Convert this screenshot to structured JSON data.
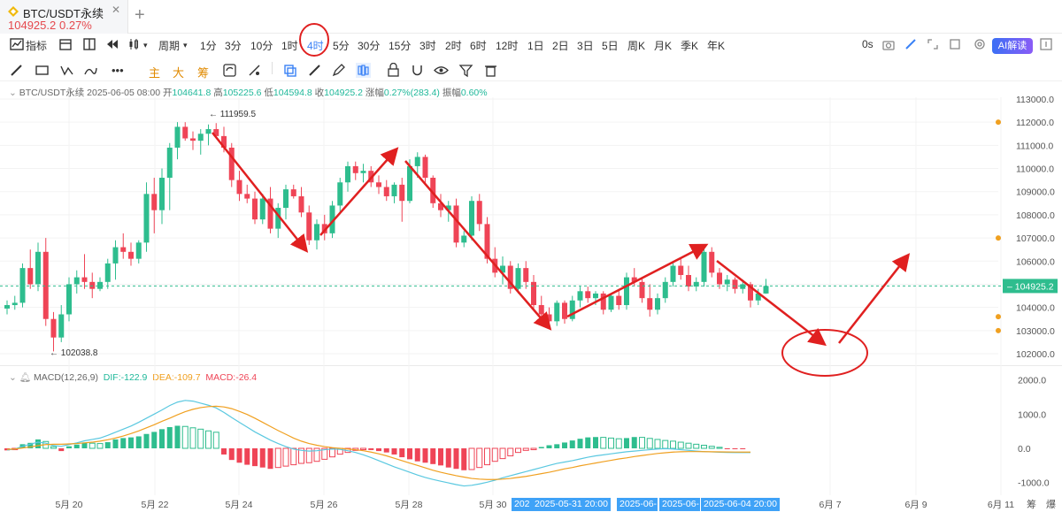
{
  "tab": {
    "symbol": "BTC/USDT永续",
    "price": "104925.2",
    "change_pct": "0.27%",
    "close_icon": "close-icon",
    "add_icon": "plus-icon"
  },
  "toolbar": {
    "indicator_label": "指标",
    "period_label": "周期",
    "intervals": [
      "1分",
      "3分",
      "10分",
      "1时",
      "4时",
      "5分",
      "30分",
      "15分",
      "3时",
      "2时",
      "6时",
      "12时",
      "1日",
      "2日",
      "3日",
      "5日",
      "周K",
      "月K",
      "季K",
      "年K"
    ],
    "active_interval": "4时",
    "countdown": "0s",
    "ai_button": "AI解读"
  },
  "drawing_tools": {
    "text_tools": [
      "主",
      "大",
      "筹"
    ]
  },
  "info": {
    "title": "BTC/USDT永续",
    "datetime": "2025-06-05 08:00",
    "open_label": "开",
    "open": "104641.8",
    "high_label": "高",
    "high": "105225.6",
    "low_label": "低",
    "low": "104594.8",
    "close_label": "收",
    "close": "104925.2",
    "change_label": "涨幅",
    "change": "0.27%(283.4)",
    "amplitude_label": "振幅",
    "amplitude": "0.60%"
  },
  "macd": {
    "label": "MACD(12,26,9)",
    "dif": "DIF:-122.9",
    "dea": "DEA:-109.7",
    "macd": "MACD:-26.4",
    "y_ticks": [
      "2000.0",
      "1000.0",
      "0.0",
      "-1000.0"
    ]
  },
  "colors": {
    "up": "#2ebd8e",
    "down": "#ef4456",
    "dif": "#5ac8e0",
    "dea": "#f0a020",
    "annotation": "#e02020",
    "accent": "#3b82f6"
  },
  "chart_data": {
    "type": "candlestick",
    "y_ticks": [
      "113000.0",
      "112000.0",
      "111000.0",
      "110000.0",
      "109000.0",
      "108000.0",
      "107000.0",
      "106000.0",
      "105000.0",
      "104000.0",
      "103000.0",
      "102000.0"
    ],
    "ylim": [
      101600,
      113200
    ],
    "high_marker": "111959.5",
    "low_marker": "102038.8",
    "last_price": "104925.2",
    "x_ticks": [
      "5月 20",
      "5月 22",
      "5月 24",
      "5月 26",
      "5月 28",
      "5月 30",
      "6月 7",
      "6月 9",
      "6月 11"
    ],
    "crosshair_labels": [
      "2025-05-31 20:00",
      "2025-06-04 20:00"
    ],
    "crosshair_truncated": [
      "202",
      "2025-06-",
      "2025-06-"
    ],
    "right_bottom_labels": [
      "筹",
      "爆"
    ],
    "candles": [
      [
        103950,
        104300,
        103700,
        104100
      ],
      [
        104100,
        104500,
        103900,
        104200
      ],
      [
        104200,
        105900,
        104000,
        105700
      ],
      [
        105700,
        106500,
        104800,
        105000
      ],
      [
        105000,
        106800,
        104700,
        106400
      ],
      [
        106400,
        107000,
        103200,
        103500
      ],
      [
        103500,
        103800,
        102100,
        102700
      ],
      [
        102700,
        104100,
        102500,
        103700
      ],
      [
        103700,
        105300,
        103400,
        105000
      ],
      [
        105000,
        105600,
        104600,
        105300
      ],
      [
        105300,
        106300,
        104800,
        105100
      ],
      [
        105100,
        105500,
        104400,
        104800
      ],
      [
        104800,
        105300,
        104700,
        105100
      ],
      [
        105100,
        106100,
        104800,
        105900
      ],
      [
        105900,
        106900,
        105200,
        106600
      ],
      [
        106600,
        107200,
        106100,
        106400
      ],
      [
        106400,
        106800,
        105800,
        106100
      ],
      [
        106100,
        106900,
        105900,
        106800
      ],
      [
        106800,
        109400,
        106400,
        108900
      ],
      [
        108900,
        109600,
        107200,
        108200
      ],
      [
        108200,
        110000,
        107600,
        109600
      ],
      [
        109600,
        111100,
        108200,
        110900
      ],
      [
        110900,
        112000,
        110400,
        111800
      ],
      [
        111800,
        112000,
        111200,
        111300
      ],
      [
        111300,
        111600,
        110800,
        111200
      ],
      [
        111200,
        111700,
        110600,
        111500
      ],
      [
        111500,
        111900,
        111000,
        111700
      ],
      [
        111700,
        111960,
        111300,
        111400
      ],
      [
        111400,
        111800,
        110700,
        110900
      ],
      [
        110900,
        111100,
        109200,
        109500
      ],
      [
        109500,
        109900,
        108600,
        108900
      ],
      [
        108900,
        109300,
        108500,
        108700
      ],
      [
        108700,
        109000,
        107600,
        107800
      ],
      [
        107800,
        108900,
        107600,
        108700
      ],
      [
        108700,
        109200,
        107200,
        107400
      ],
      [
        107400,
        108500,
        107000,
        108300
      ],
      [
        108300,
        109300,
        107800,
        109100
      ],
      [
        109100,
        109300,
        108700,
        108800
      ],
      [
        108800,
        109200,
        107900,
        108100
      ],
      [
        108100,
        108400,
        106700,
        106900
      ],
      [
        106900,
        107800,
        106500,
        107600
      ],
      [
        107600,
        108000,
        106900,
        107200
      ],
      [
        107200,
        108600,
        107000,
        108400
      ],
      [
        108400,
        109600,
        108100,
        109400
      ],
      [
        109400,
        110300,
        109000,
        110100
      ],
      [
        110100,
        110300,
        109500,
        109800
      ],
      [
        109800,
        110200,
        109400,
        109900
      ],
      [
        109900,
        110100,
        109200,
        109400
      ],
      [
        109400,
        109700,
        108900,
        109200
      ],
      [
        109200,
        109500,
        108600,
        108800
      ],
      [
        108800,
        109400,
        108500,
        109300
      ],
      [
        109300,
        109600,
        107700,
        108600
      ],
      [
        108600,
        110400,
        108500,
        110100
      ],
      [
        110100,
        110700,
        109600,
        110500
      ],
      [
        110500,
        110600,
        109300,
        109600
      ],
      [
        109600,
        109700,
        108300,
        108500
      ],
      [
        108500,
        108900,
        107900,
        108200
      ],
      [
        108200,
        108600,
        107700,
        108400
      ],
      [
        108400,
        108700,
        106600,
        106800
      ],
      [
        106800,
        107300,
        106600,
        107100
      ],
      [
        107100,
        108800,
        106900,
        108600
      ],
      [
        108600,
        108900,
        107300,
        107600
      ],
      [
        107600,
        107900,
        105900,
        106100
      ],
      [
        106100,
        106600,
        105300,
        105500
      ],
      [
        105500,
        106200,
        105000,
        105800
      ],
      [
        105800,
        106000,
        104600,
        104800
      ],
      [
        104800,
        105900,
        104600,
        105700
      ],
      [
        105700,
        106000,
        104800,
        105100
      ],
      [
        105100,
        105400,
        103900,
        104100
      ],
      [
        104100,
        104500,
        103500,
        103700
      ],
      [
        103700,
        104000,
        103200,
        103400
      ],
      [
        103400,
        104300,
        103200,
        104200
      ],
      [
        104200,
        104300,
        103300,
        103500
      ],
      [
        103500,
        104500,
        103400,
        104300
      ],
      [
        104300,
        104900,
        104000,
        104700
      ],
      [
        104700,
        104900,
        104200,
        104400
      ],
      [
        104400,
        104700,
        104100,
        104600
      ],
      [
        104600,
        104700,
        103700,
        103900
      ],
      [
        103900,
        104600,
        103800,
        104500
      ],
      [
        104500,
        104800,
        103900,
        104100
      ],
      [
        104100,
        105500,
        103900,
        105300
      ],
      [
        105300,
        105700,
        104900,
        105100
      ],
      [
        105100,
        105300,
        104200,
        104400
      ],
      [
        104400,
        105000,
        103600,
        103900
      ],
      [
        103900,
        104600,
        103700,
        104400
      ],
      [
        104400,
        105300,
        104200,
        105100
      ],
      [
        105100,
        106000,
        104900,
        105800
      ],
      [
        105800,
        106100,
        105200,
        105400
      ],
      [
        105400,
        105800,
        104700,
        104900
      ],
      [
        104900,
        105300,
        104700,
        105100
      ],
      [
        105100,
        106600,
        104900,
        106400
      ],
      [
        106400,
        106600,
        105300,
        105500
      ],
      [
        105500,
        105700,
        104800,
        105000
      ],
      [
        105000,
        105400,
        104700,
        105200
      ],
      [
        105200,
        105300,
        104600,
        104800
      ],
      [
        104800,
        105200,
        104600,
        105000
      ],
      [
        105000,
        105100,
        104000,
        104300
      ],
      [
        104300,
        104800,
        104100,
        104600
      ],
      [
        104600,
        105230,
        104590,
        104925
      ]
    ],
    "macd_hist": [
      -60,
      -40,
      120,
      160,
      260,
      200,
      50,
      -80,
      60,
      110,
      170,
      150,
      140,
      180,
      260,
      300,
      320,
      350,
      420,
      480,
      560,
      620,
      660,
      640,
      600,
      560,
      510,
      470,
      -180,
      -340,
      -420,
      -480,
      -520,
      -560,
      -600,
      -560,
      -520,
      -480,
      -440,
      -420,
      -380,
      -320,
      -250,
      -170,
      -120,
      -60,
      -40,
      -50,
      -80,
      -120,
      -180,
      -260,
      -320,
      -380,
      -420,
      -460,
      -500,
      -560,
      -600,
      -640,
      -620,
      -560,
      -480,
      -380,
      -300,
      -220,
      -120,
      -60,
      -40,
      40,
      90,
      120,
      170,
      230,
      280,
      320,
      330,
      320,
      300,
      280,
      300,
      330,
      320,
      290,
      260,
      230,
      210,
      180,
      150,
      120,
      90,
      60,
      30,
      -10,
      -20,
      -26
    ],
    "dif": [
      -50,
      -20,
      60,
      120,
      180,
      150,
      80,
      60,
      110,
      160,
      220,
      260,
      300,
      380,
      470,
      560,
      650,
      760,
      880,
      1000,
      1120,
      1250,
      1350,
      1400,
      1380,
      1320,
      1260,
      1180,
      1050,
      900,
      760,
      620,
      480,
      360,
      240,
      140,
      50,
      -20,
      -60,
      -80,
      -70,
      -40,
      -20,
      -30,
      -70,
      -120,
      -190,
      -270,
      -360,
      -450,
      -540,
      -620,
      -700,
      -780,
      -850,
      -910,
      -960,
      -1010,
      -1060,
      -1100,
      -1080,
      -1040,
      -990,
      -930,
      -860,
      -800,
      -740,
      -680,
      -620,
      -560,
      -500,
      -440,
      -400,
      -360,
      -310,
      -260,
      -220,
      -190,
      -160,
      -130,
      -100,
      -80,
      -60,
      -40,
      -20,
      -10,
      -20,
      -40,
      -60,
      -80,
      -95,
      -105,
      -115,
      -120,
      -122,
      -123,
      -123
    ],
    "dea": [
      -30,
      -20,
      10,
      40,
      80,
      110,
      120,
      120,
      130,
      140,
      160,
      180,
      210,
      250,
      300,
      360,
      430,
      510,
      600,
      690,
      790,
      880,
      980,
      1070,
      1140,
      1190,
      1220,
      1230,
      1210,
      1160,
      1080,
      990,
      880,
      760,
      640,
      520,
      410,
      300,
      210,
      140,
      90,
      50,
      20,
      0,
      -20,
      -40,
      -70,
      -110,
      -160,
      -220,
      -290,
      -360,
      -430,
      -500,
      -570,
      -640,
      -700,
      -750,
      -800,
      -840,
      -880,
      -900,
      -910,
      -910,
      -900,
      -880,
      -850,
      -820,
      -780,
      -740,
      -700,
      -650,
      -600,
      -560,
      -510,
      -470,
      -430,
      -390,
      -350,
      -310,
      -280,
      -240,
      -210,
      -180,
      -150,
      -130,
      -110,
      -100,
      -95,
      -95,
      -97,
      -100,
      -103,
      -106,
      -108,
      -109,
      -110
    ]
  }
}
